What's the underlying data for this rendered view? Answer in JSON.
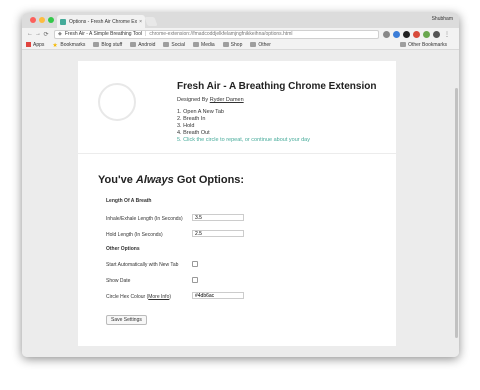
{
  "browser": {
    "tab_title": "Options - Fresh Air Chrome Ex",
    "tab_close": "×",
    "profile_name": "Shubham",
    "omnibox_scope": "Fresh Air - A Simple Breathing Tool",
    "omnibox_url": "chrome-extension://fmadcoddjelkfelamjngfnikkeihna/options.html",
    "bookmarks": [
      "Apps",
      "Bookmarks",
      "Blog stuff",
      "Android",
      "Social",
      "Media",
      "Shop",
      "Other"
    ],
    "other_bookmarks": "Other Bookmarks"
  },
  "header": {
    "title": "Fresh Air - A Breathing Chrome Extension",
    "byline_prefix": "Designed By",
    "author": "Ryder Damen",
    "steps": [
      "1. Open A New Tab",
      "2. Breath In",
      "3. Hold",
      "4. Breath Out"
    ],
    "note": "5. Click the circle to repeat, or continue about your day"
  },
  "options": {
    "heading_pre": "You've",
    "heading_em": "Always",
    "heading_post": "Got Options:",
    "section_breath": "Length Of A Breath",
    "inhale_label": "Inhale/Exhale Length (In Seconds)",
    "inhale_value": "3.5",
    "hold_label": "Hold Length (In Seconds)",
    "hold_value": "2.5",
    "section_other": "Other Options",
    "auto_start_label": "Start Automatically with New Tab",
    "show_date_label": "Show Date",
    "hex_label": "Circle Hex Colour (",
    "hex_link": "More Info",
    "hex_label_end": ")",
    "hex_value": "#4db6ac",
    "save_label": "Save Settings"
  },
  "colors": {
    "accent": "#44aa99"
  }
}
